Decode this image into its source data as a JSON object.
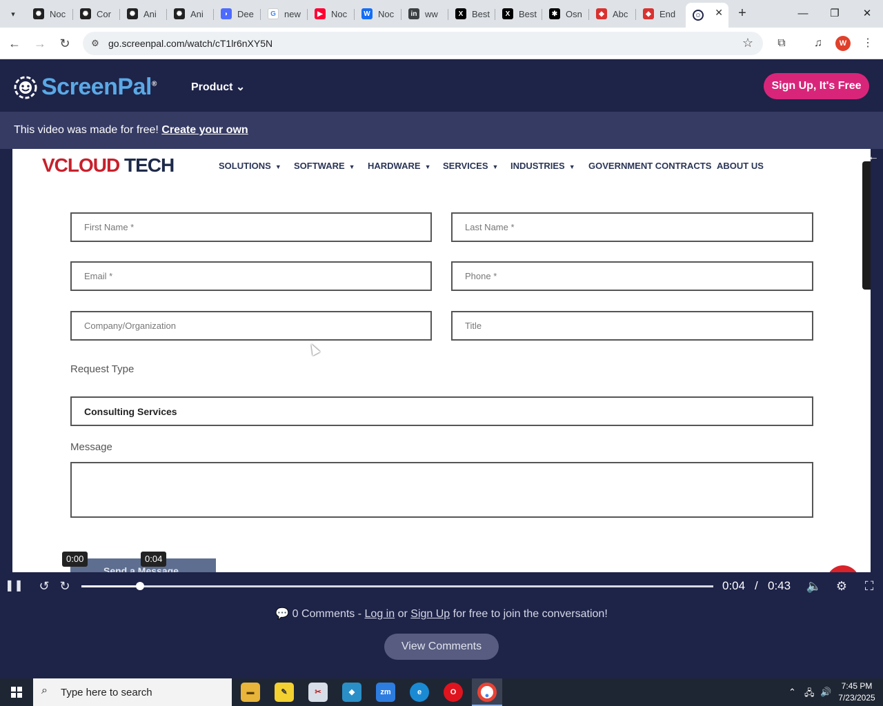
{
  "browser": {
    "tabs": [
      {
        "label": "Noc",
        "icon": "openai-icon",
        "color": "#222222"
      },
      {
        "label": "Cor",
        "icon": "openai-icon",
        "color": "#222222"
      },
      {
        "label": "Ani",
        "icon": "openai-icon",
        "color": "#222222"
      },
      {
        "label": "Ani",
        "icon": "openai-icon",
        "color": "#222222"
      },
      {
        "label": "Dee",
        "icon": "deepseek-icon",
        "color": "#4d6bfe"
      },
      {
        "label": "new",
        "icon": "google-icon",
        "color": "#4285f4"
      },
      {
        "label": "Noc",
        "icon": "youtube-icon",
        "color": "#ff0033"
      },
      {
        "label": "Noc",
        "icon": "webflow-icon",
        "color": "#146ef5"
      },
      {
        "label": "ww",
        "icon": "linkedin-icon",
        "color": "#0a66c2"
      },
      {
        "label": "Best",
        "icon": "x-icon",
        "color": "#000000"
      },
      {
        "label": "Best",
        "icon": "x-icon",
        "color": "#000000"
      },
      {
        "label": "Osn",
        "icon": "asterisk-icon",
        "color": "#000000"
      },
      {
        "label": "Abc",
        "icon": "diamond-icon",
        "color": "#d9322f"
      },
      {
        "label": "End",
        "icon": "diamond-icon",
        "color": "#d9322f"
      }
    ],
    "active_tab_icon": "screenpal-icon",
    "url": "go.screenpal.com/watch/cT1lr6nXY5N",
    "profile_initial": "W"
  },
  "site": {
    "brand": "ScreenPal",
    "product_menu": "Product",
    "signup_button": "Sign Up, It's Free",
    "banner_text": "This video was made for free!",
    "banner_link": "Create your own"
  },
  "video": {
    "logo_part1": "VCLOUD",
    "logo_part2": "TECH",
    "menu": [
      "SOLUTIONS",
      "SOFTWARE",
      "HARDWARE",
      "SERVICES",
      "INDUSTRIES",
      "GOVERNMENT CONTRACTS",
      "ABOUT US"
    ],
    "form": {
      "first_name": "First Name *",
      "last_name": "Last Name *",
      "email": "Email *",
      "phone": "Phone *",
      "company": "Company/Organization",
      "title": "Title",
      "request_type_label": "Request Type",
      "request_type_value": "Consulting Services",
      "message_label": "Message",
      "submit": "Send a Message"
    },
    "bubble_start": "0:00",
    "bubble_current": "0:04"
  },
  "player": {
    "current_time": "0:04",
    "separator": "/",
    "duration": "0:43",
    "progress_fraction": 0.093
  },
  "comments": {
    "count_text": "0 Comments -",
    "login": "Log in",
    "or": "or",
    "signup": "Sign Up",
    "suffix": "for free to join the conversation!",
    "view_button": "View Comments"
  },
  "taskbar": {
    "search_placeholder": "Type here to search",
    "time": "7:45 PM",
    "date": "7/23/2025"
  }
}
